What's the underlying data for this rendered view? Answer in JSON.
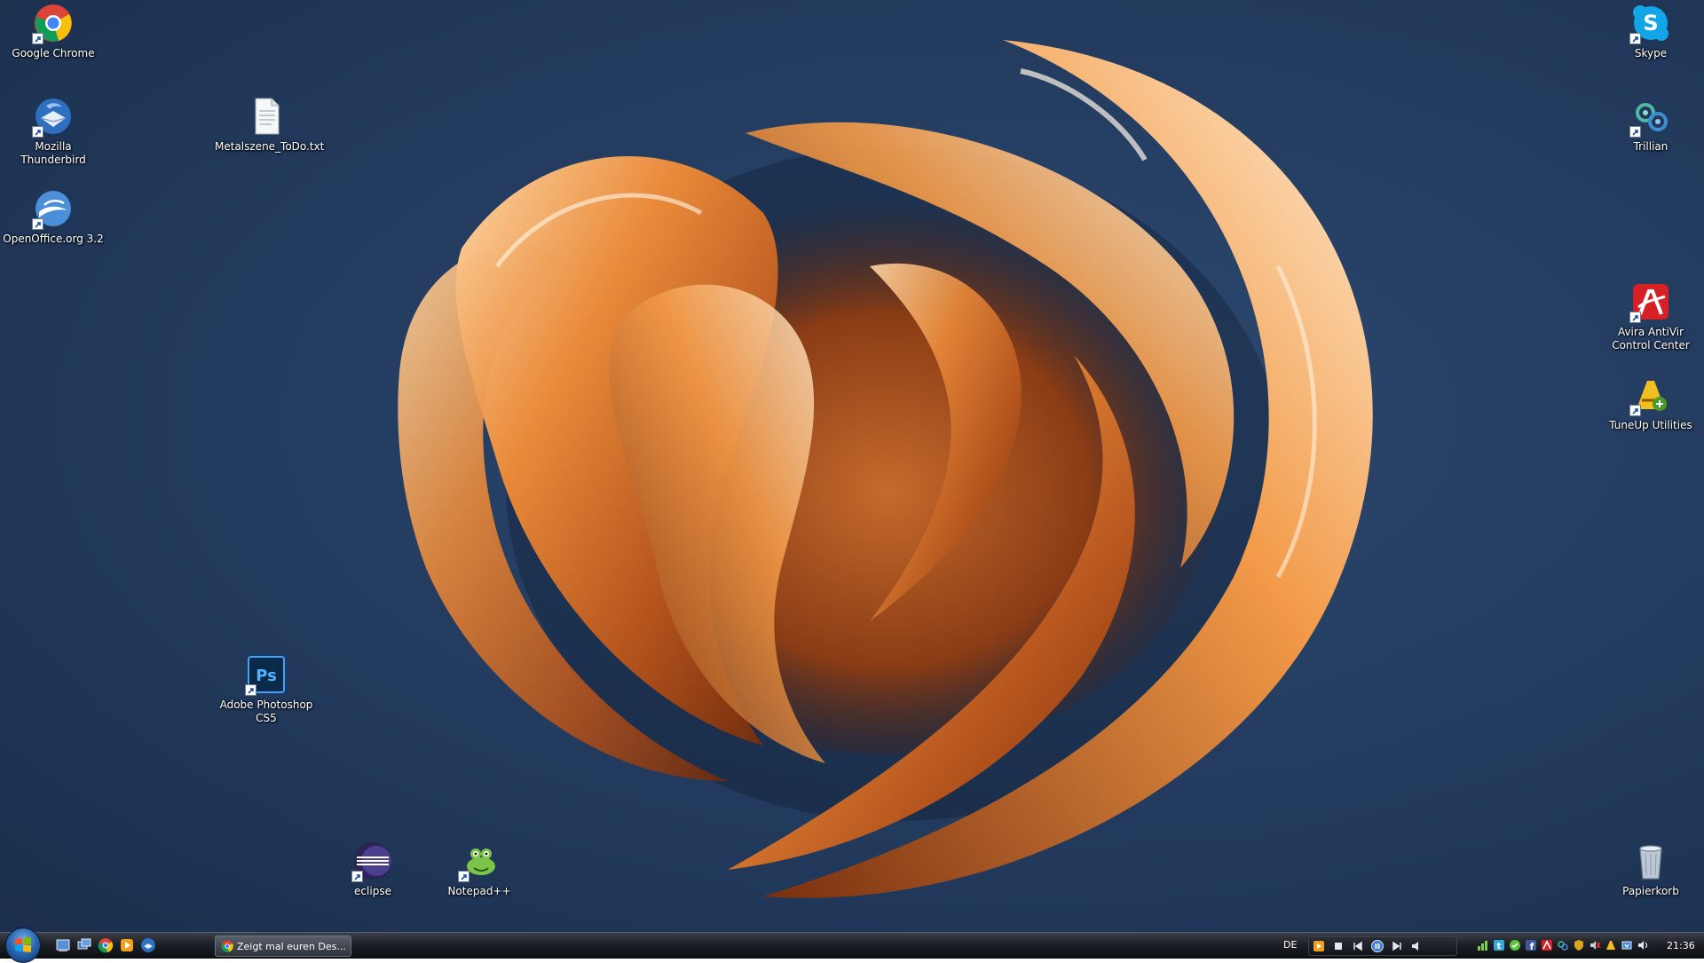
{
  "desktop": {
    "icons": [
      {
        "id": "chrome",
        "label": "Google Chrome",
        "icon": "chrome-icon",
        "shortcut": true
      },
      {
        "id": "thunderbird",
        "label": "Mozilla Thunderbird",
        "icon": "thunderbird-icon",
        "shortcut": true
      },
      {
        "id": "openoffice",
        "label": "OpenOffice.org 3.2",
        "icon": "openoffice-icon",
        "shortcut": true
      },
      {
        "id": "todo",
        "label": "Metalszene_ToDo.txt",
        "icon": "text-file-icon",
        "shortcut": false
      },
      {
        "id": "photoshop",
        "label": "Adobe Photoshop CS5",
        "icon": "photoshop-icon",
        "shortcut": true
      },
      {
        "id": "eclipse",
        "label": "eclipse",
        "icon": "eclipse-icon",
        "shortcut": true
      },
      {
        "id": "notepadpp",
        "label": "Notepad++",
        "icon": "notepadpp-icon",
        "shortcut": true
      },
      {
        "id": "skype",
        "label": "Skype",
        "icon": "skype-icon",
        "shortcut": true
      },
      {
        "id": "trillian",
        "label": "Trillian",
        "icon": "trillian-icon",
        "shortcut": true
      },
      {
        "id": "avira",
        "label": "Avira AntiVir Control Center",
        "icon": "avira-icon",
        "shortcut": true
      },
      {
        "id": "tuneup",
        "label": "TuneUp Utilities",
        "icon": "tuneup-icon",
        "shortcut": true
      },
      {
        "id": "recycle",
        "label": "Papierkorb",
        "icon": "recycle-bin-icon",
        "shortcut": false
      }
    ]
  },
  "taskbar": {
    "start_icon": "windows-logo-icon",
    "quick_launch": [
      "show-desktop-icon",
      "switch-windows-icon",
      "chrome-icon",
      "media-player-icon",
      "thunderbird-icon"
    ],
    "task_button_label": "Zeigt mal euren Des...",
    "task_button_icon": "chrome-icon",
    "language": "DE",
    "media_controls": [
      "player-icon",
      "stop-icon",
      "previous-icon",
      "pause-icon",
      "next-icon",
      "volume-icon"
    ],
    "tray_icons": [
      "network-icon",
      "twitter-icon",
      "chat-icon",
      "facebook-icon",
      "avira-icon",
      "trillian-icon",
      "security-icon",
      "speaker-muted-icon",
      "tuneup-icon",
      "safely-remove-icon",
      "volume-icon"
    ],
    "clock": "21:36"
  },
  "colors": {
    "desktop_background": "#243d61",
    "wallpaper_accent": "#e07a2a",
    "taskbar": "#1d2026"
  }
}
